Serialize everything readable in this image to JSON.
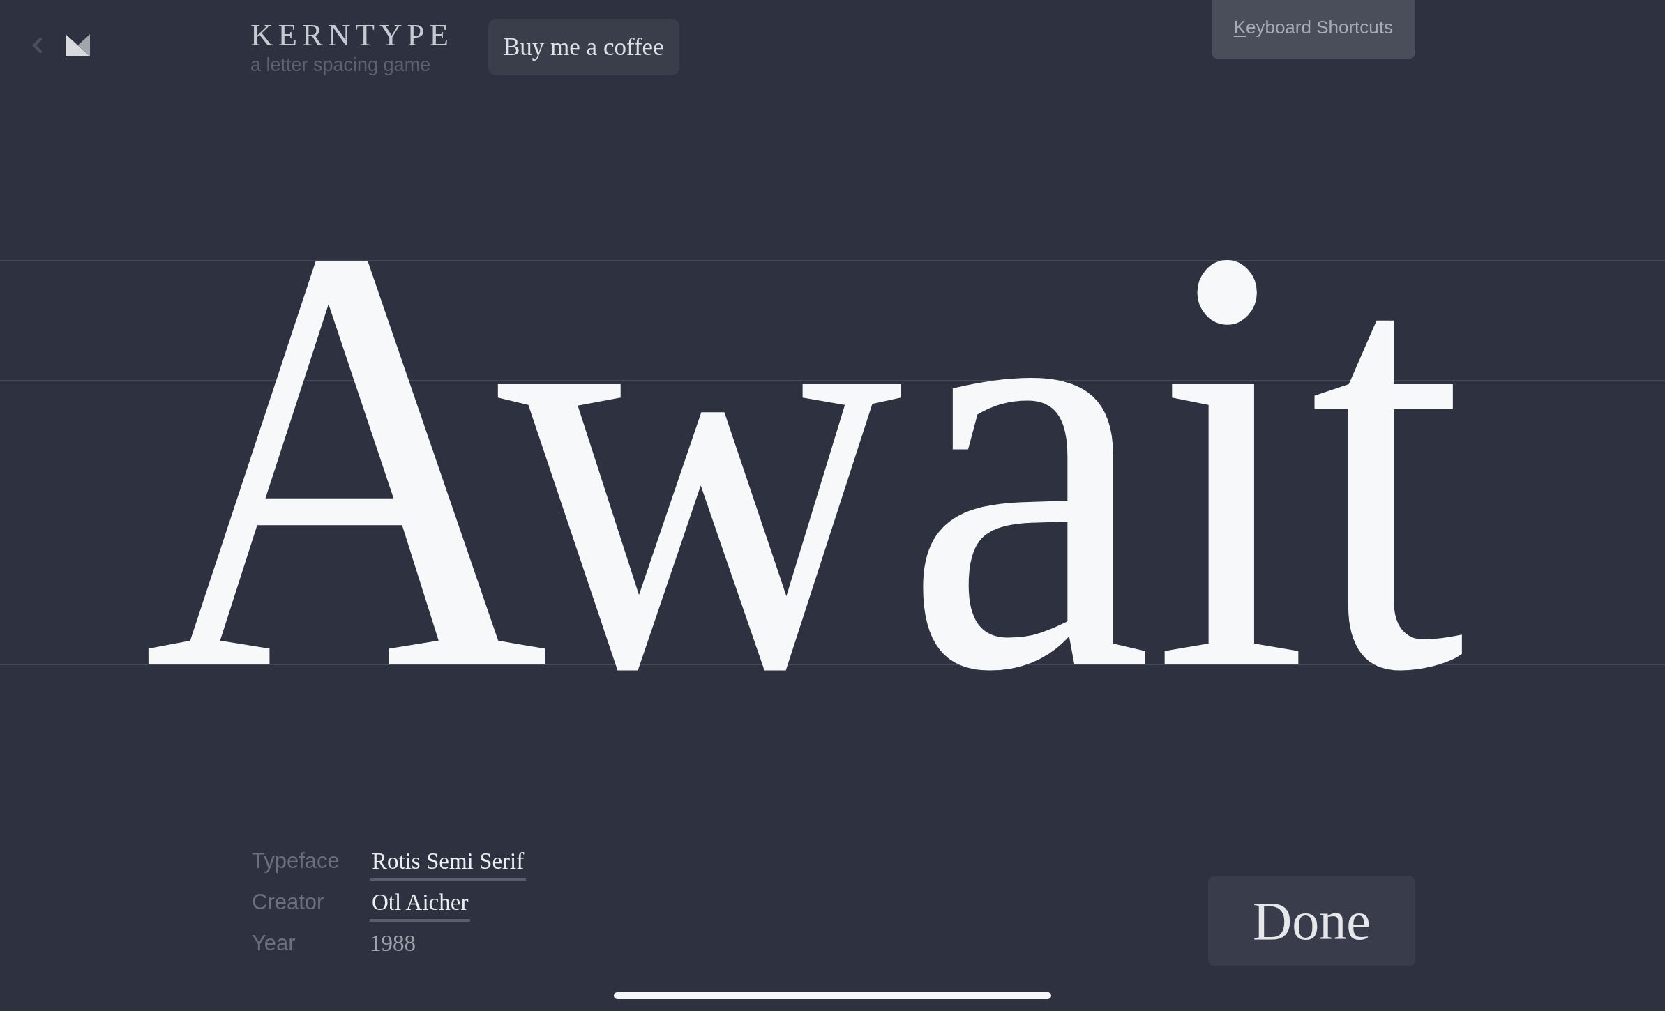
{
  "brand": {
    "title": "KERNTYPE",
    "tagline": "a letter spacing game"
  },
  "donate_button": {
    "label": "Buy me a coffee"
  },
  "shortcuts_button": {
    "label": "Keyboard Shortcuts"
  },
  "word": "Await",
  "font_info": [
    {
      "kind": "link",
      "label": "Typeface",
      "value": "Rotis Semi Serif"
    },
    {
      "kind": "link",
      "label": "Creator",
      "value": "Otl Aicher"
    },
    {
      "kind": "plain",
      "label": "Year",
      "value": "1988"
    }
  ],
  "done_button": {
    "label": "Done"
  }
}
